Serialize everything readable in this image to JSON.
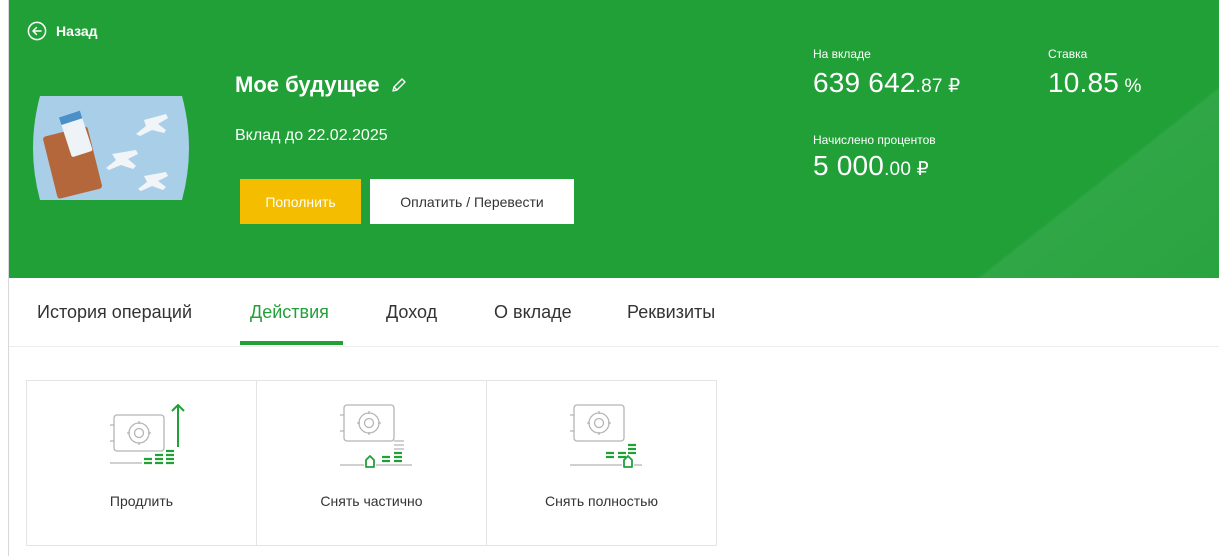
{
  "header": {
    "back_label": "Назад",
    "deposit_name": "Мое будущее",
    "deposit_until": "Вклад до 22.02.2025",
    "topup_label": "Пополнить",
    "pay_label": "Оплатить / Перевести",
    "balance_label": "На вкладе",
    "balance_main": "639 642",
    "balance_fraction": ".87 ₽",
    "rate_label": "Ставка",
    "rate_main": "10.85",
    "rate_unit": " %",
    "interest_label": "Начислено процентов",
    "interest_main": "5 000",
    "interest_fraction": ".00 ₽"
  },
  "tabs": [
    {
      "label": "История операций",
      "active": false
    },
    {
      "label": "Действия",
      "active": true
    },
    {
      "label": "Доход",
      "active": false
    },
    {
      "label": "О вкладе",
      "active": false
    },
    {
      "label": "Реквизиты",
      "active": false
    }
  ],
  "actions": [
    {
      "label": "Продлить",
      "icon": "safe-extend-icon"
    },
    {
      "label": "Снять частично",
      "icon": "safe-withdraw-partial-icon"
    },
    {
      "label": "Снять полностью",
      "icon": "safe-withdraw-full-icon"
    }
  ],
  "colors": {
    "brand_green": "#21a038",
    "accent_yellow": "#f5bd00",
    "icon_gray": "#b5b5b5"
  }
}
